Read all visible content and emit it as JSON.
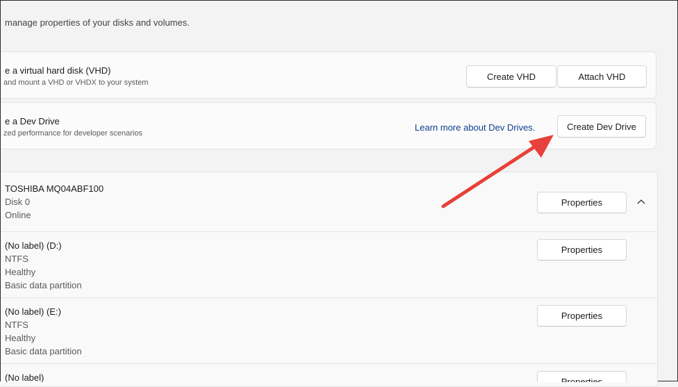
{
  "header": {
    "subtitle": "manage properties of your disks and volumes."
  },
  "vhd_card": {
    "title": "e a virtual hard disk (VHD)",
    "description": "and mount a VHD or VHDX to your system",
    "create_label": "Create VHD",
    "attach_label": "Attach VHD"
  },
  "devdrive_card": {
    "title": "e a Dev Drive",
    "description": "zed performance for developer scenarios",
    "learn_more": "Learn more about Dev Drives.",
    "create_label": "Create Dev Drive"
  },
  "disk": {
    "name": "TOSHIBA MQ04ABF100",
    "number": "Disk 0",
    "status": "Online",
    "properties_label": "Properties"
  },
  "volumes": [
    {
      "label": "(No label) (D:)",
      "fs": "NTFS",
      "health": "Healthy",
      "type": "Basic data partition",
      "properties_label": "Properties"
    },
    {
      "label": "(No label) (E:)",
      "fs": "NTFS",
      "health": "Healthy",
      "type": "Basic data partition",
      "properties_label": "Properties"
    },
    {
      "label": "(No label)",
      "properties_label": "Properties"
    }
  ],
  "annotation": {
    "arrow_color": "#e8403a"
  }
}
